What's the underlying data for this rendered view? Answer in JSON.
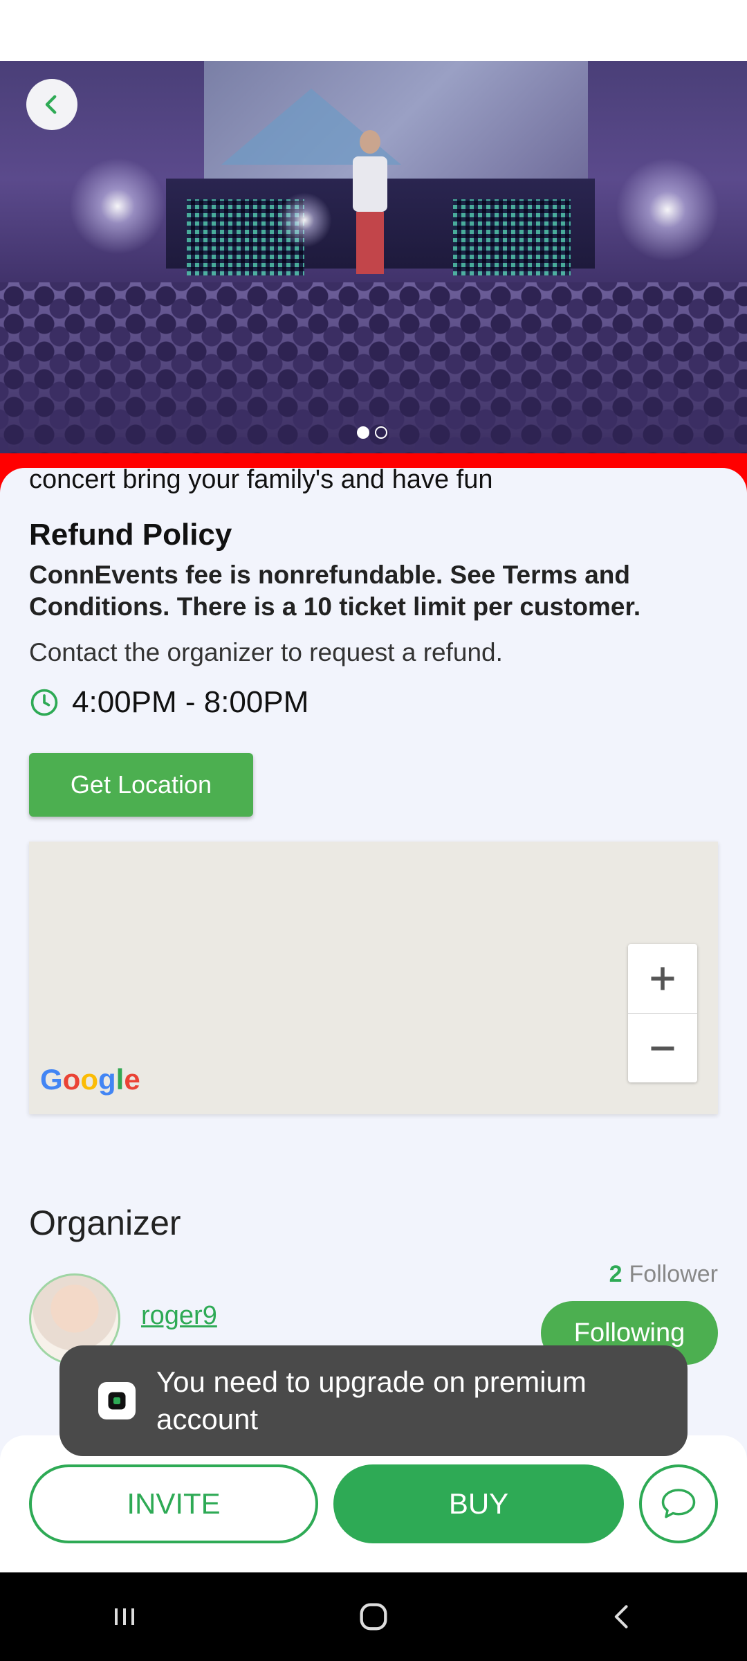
{
  "event": {
    "description_tail": "concert bring your family's and have fun",
    "refund_title": "Refund Policy",
    "refund_body": "ConnEvents fee is nonrefundable. See Terms and Conditions. There is a 10 ticket limit per customer.",
    "contact_note": "Contact the organizer to request a refund.",
    "time_range": "4:00PM - 8:00PM",
    "get_location_label": "Get Location"
  },
  "carousel": {
    "total": 2,
    "active": 1
  },
  "map": {
    "brand": "Google",
    "zoom_in": "+",
    "zoom_out": "−"
  },
  "organizer": {
    "section_title": "Organizer",
    "username": "roger9",
    "follower_count": "2",
    "follower_label": "Follower",
    "follow_button": "Following"
  },
  "toast": {
    "message": "You need to upgrade on premium account"
  },
  "actions": {
    "invite_label": "INVITE",
    "buy_label": "BUY"
  },
  "colors": {
    "accent": "#2eaa55",
    "button_green": "#4caf50",
    "band_red": "#ff0000"
  },
  "icons": {
    "back": "chevron-left-icon",
    "clock": "clock-icon",
    "chat": "chat-bubble-icon",
    "nav_recent": "recent-apps-icon",
    "nav_home": "home-icon",
    "nav_back": "back-icon"
  }
}
